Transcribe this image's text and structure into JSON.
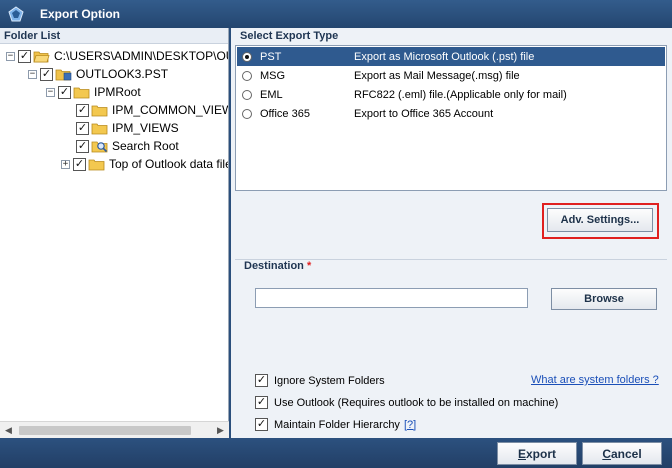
{
  "window": {
    "title": "Export Option"
  },
  "folder_list": {
    "header": "Folder List",
    "items": [
      {
        "label": "C:\\USERS\\ADMIN\\DESKTOP\\OUTL«",
        "expander": "−",
        "checked": "✓"
      },
      {
        "label": "OUTLOOK3.PST",
        "expander": "−",
        "checked": "✓"
      },
      {
        "label": "IPMRoot",
        "expander": "−",
        "checked": "✓"
      },
      {
        "label": "IPM_COMMON_VIEWS",
        "checked": "✓"
      },
      {
        "label": "IPM_VIEWS",
        "checked": "✓"
      },
      {
        "label": "Search Root",
        "checked": "✓"
      },
      {
        "label": "Top of Outlook data file",
        "expander": "+",
        "checked": "✓"
      }
    ],
    "scroll_left": "◀",
    "scroll_right": "▶"
  },
  "export_type": {
    "header": "Select Export Type",
    "options": [
      {
        "name": "PST",
        "desc": "Export as Microsoft Outlook (.pst) file"
      },
      {
        "name": "MSG",
        "desc": "Export as Mail Message(.msg) file"
      },
      {
        "name": "EML",
        "desc": "RFC822 (.eml) file.(Applicable only for mail)"
      },
      {
        "name": "Office 365",
        "desc": "Export to Office 365 Account"
      }
    ],
    "selected": "PST"
  },
  "adv_settings_label": "Adv. Settings...",
  "destination": {
    "label": "Destination",
    "required_mark": "*",
    "value": "",
    "browse_label": "Browse"
  },
  "options": {
    "ignore_system_folders": {
      "label": "Ignore System Folders",
      "checked": "✓"
    },
    "system_folders_link": "What are system folders ?",
    "use_outlook": {
      "label": "Use Outlook (Requires outlook to be installed on machine)",
      "checked": "✓"
    },
    "maintain_hierarchy": {
      "label": "Maintain Folder Hierarchy",
      "checked": "✓"
    },
    "help_link": "[?]"
  },
  "buttons": {
    "export_first": "E",
    "export_rest": "xport",
    "cancel_first": "C",
    "cancel_rest": "ancel"
  },
  "colors": {
    "accent": "#2f5a8f",
    "highlight_box": "#e02020",
    "link": "#1a4fb8"
  }
}
